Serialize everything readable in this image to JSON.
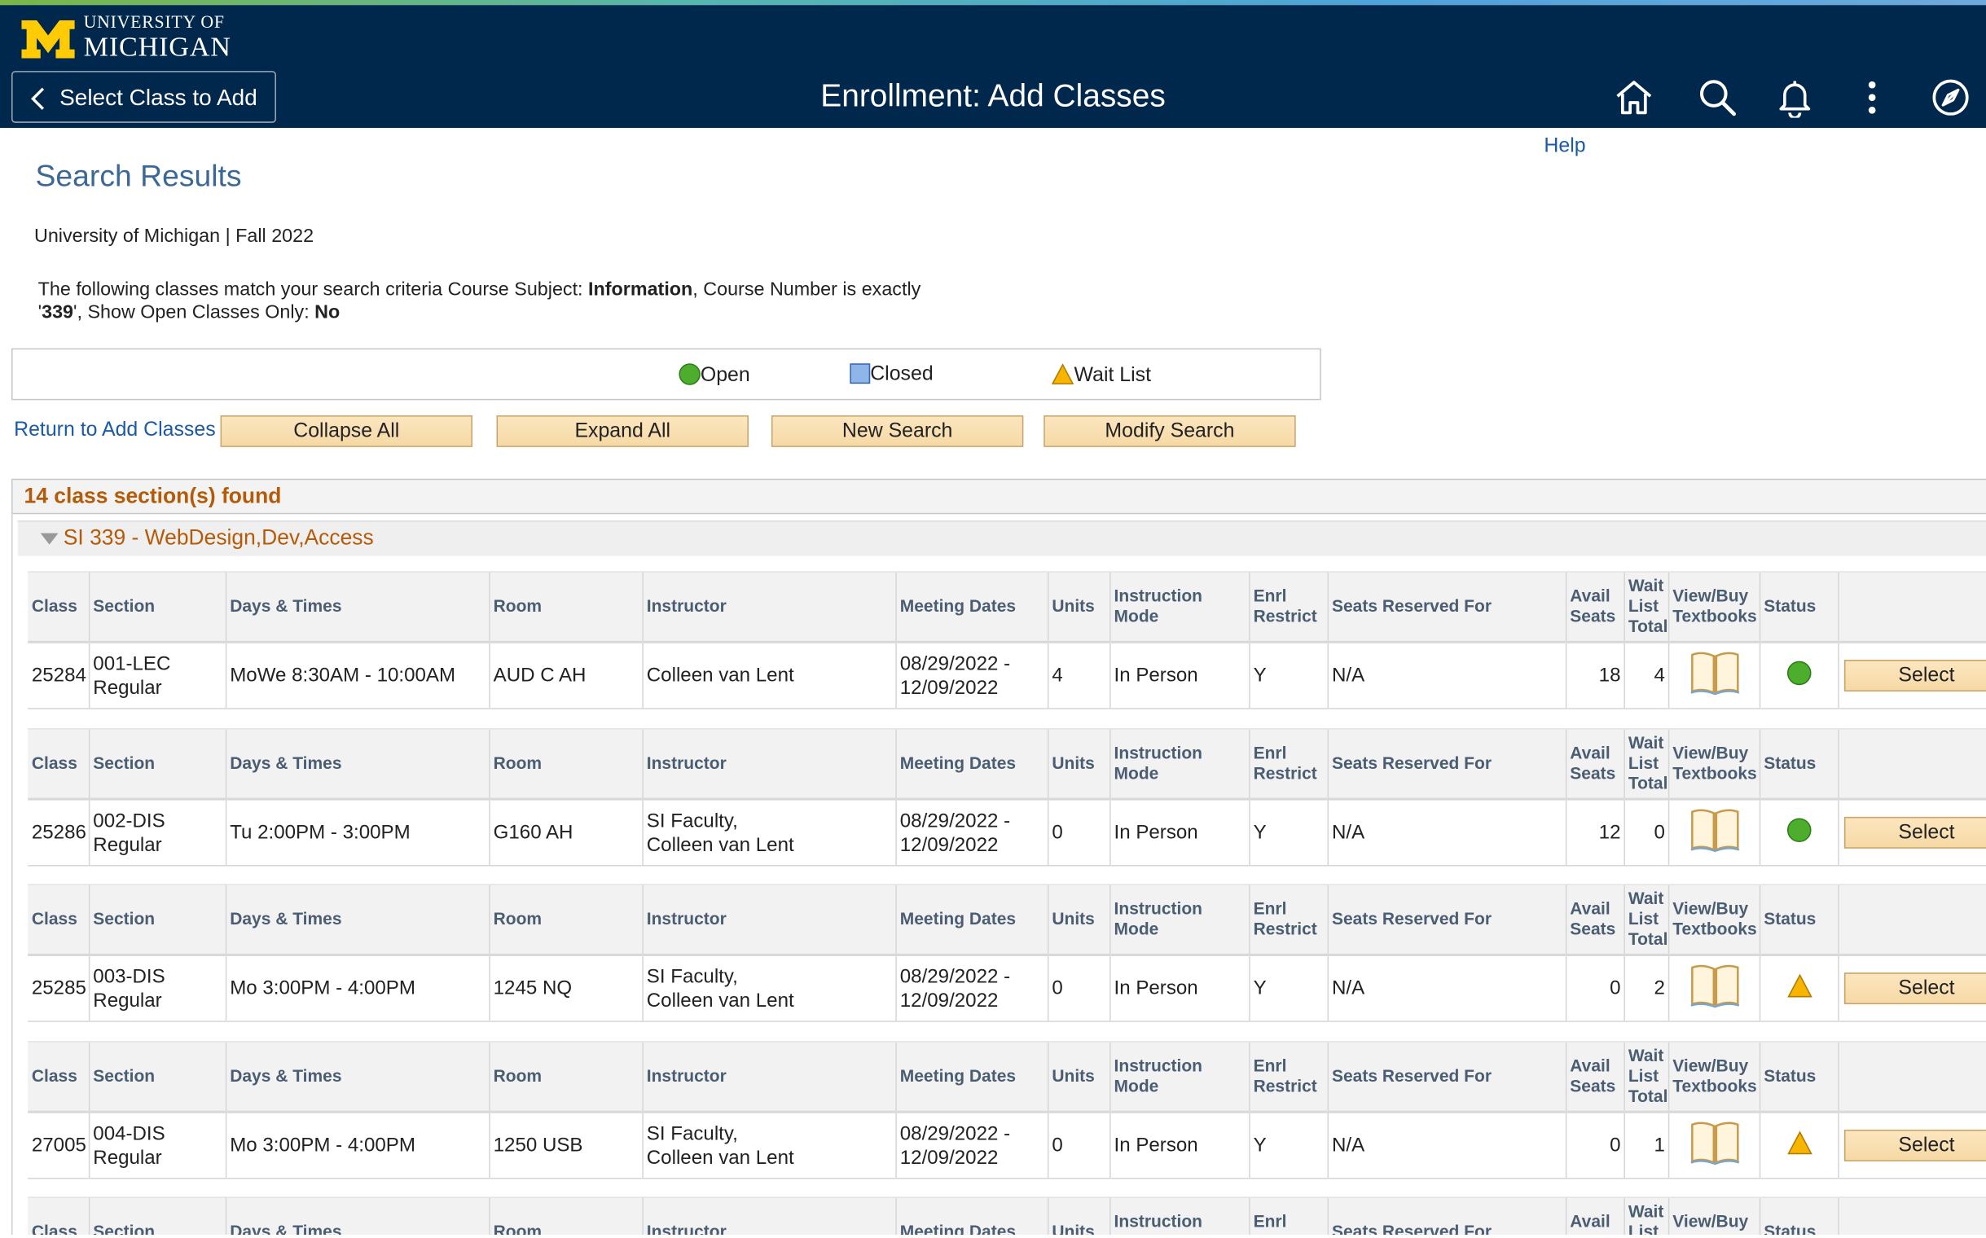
{
  "header": {
    "logo_university_of": "UNIVERSITY OF",
    "logo_michigan": "MICHIGAN",
    "back_label": "Select Class to Add",
    "title": "Enrollment: Add Classes",
    "icons": [
      "home-icon",
      "search-icon",
      "bell-icon",
      "more-vertical-icon",
      "compass-icon"
    ]
  },
  "help": "Help",
  "search_title": "Search Results",
  "term": "University of Michigan | Fall 2022",
  "criteria": {
    "prefix": "The following classes match your search criteria Course Subject: ",
    "subject": "Information",
    "course_number_label": ",  Course Number is exactly '",
    "course_number": "339",
    "open_only_label": "',  Show Open Classes Only: ",
    "open_only": "No"
  },
  "legend": {
    "open": "Open",
    "closed": "Closed",
    "waitlist": "Wait List"
  },
  "actions": {
    "return_link": "Return to Add Classes",
    "collapse": "Collapse All",
    "expand": "Expand All",
    "new_search": "New Search",
    "modify": "Modify Search"
  },
  "found": "14 class section(s) found",
  "course_title": "SI 339 - WebDesign,Dev,Access",
  "columns": {
    "class": "Class",
    "section": "Section",
    "days_times": "Days & Times",
    "room": "Room",
    "instructor": "Instructor",
    "meeting_dates": "Meeting Dates",
    "units": "Units",
    "instruction_l1": "Instruction",
    "instruction_l2": "Mode",
    "enrl_l1": "Enrl",
    "enrl_l2": "Restrict",
    "seats_reserved": "Seats Reserved For",
    "avail_l1": "Avail",
    "avail_l2": "Seats",
    "wait_l1": "Wait",
    "wait_l2": "List",
    "wait_l3": "Total",
    "view_l1": "View/Buy",
    "view_l2": "Textbooks",
    "status": "Status"
  },
  "sections": [
    {
      "class_nbr": "25284",
      "section": "001-LEC",
      "component": "Regular",
      "days_times": "MoWe 8:30AM - 10:00AM",
      "room": "AUD C AH",
      "instructor_l1": "Colleen van Lent",
      "instructor_l2": "",
      "start": "08/29/2022 -",
      "end": "12/09/2022",
      "units": "4",
      "mode": "In Person",
      "restrict": "Y",
      "reserved": "N/A",
      "avail": "18",
      "waitlist": "4",
      "status": "open",
      "select": "Select"
    },
    {
      "class_nbr": "25286",
      "section": "002-DIS",
      "component": "Regular",
      "days_times": "Tu 2:00PM - 3:00PM",
      "room": "G160 AH",
      "instructor_l1": "SI Faculty,",
      "instructor_l2": "Colleen van Lent",
      "start": "08/29/2022 -",
      "end": "12/09/2022",
      "units": "0",
      "mode": "In Person",
      "restrict": "Y",
      "reserved": "N/A",
      "avail": "12",
      "waitlist": "0",
      "status": "open",
      "select": "Select"
    },
    {
      "class_nbr": "25285",
      "section": "003-DIS",
      "component": "Regular",
      "days_times": "Mo 3:00PM - 4:00PM",
      "room": "1245 NQ",
      "instructor_l1": "SI Faculty,",
      "instructor_l2": "Colleen van Lent",
      "start": "08/29/2022 -",
      "end": "12/09/2022",
      "units": "0",
      "mode": "In Person",
      "restrict": "Y",
      "reserved": "N/A",
      "avail": "0",
      "waitlist": "2",
      "status": "waitlist",
      "select": "Select"
    },
    {
      "class_nbr": "27005",
      "section": "004-DIS",
      "component": "Regular",
      "days_times": "Mo 3:00PM - 4:00PM",
      "room": "1250 USB",
      "instructor_l1": "SI Faculty,",
      "instructor_l2": "Colleen van Lent",
      "start": "08/29/2022 -",
      "end": "12/09/2022",
      "units": "0",
      "mode": "In Person",
      "restrict": "Y",
      "reserved": "N/A",
      "avail": "0",
      "waitlist": "1",
      "status": "waitlist",
      "select": "Select"
    }
  ],
  "colors": {
    "navy": "#00274c",
    "maize": "#ffcb05",
    "accent_orange": "#b55b07",
    "link": "#1a5aa6",
    "open_green": "#4cae2c",
    "waitlist_amber": "#f7b500"
  }
}
